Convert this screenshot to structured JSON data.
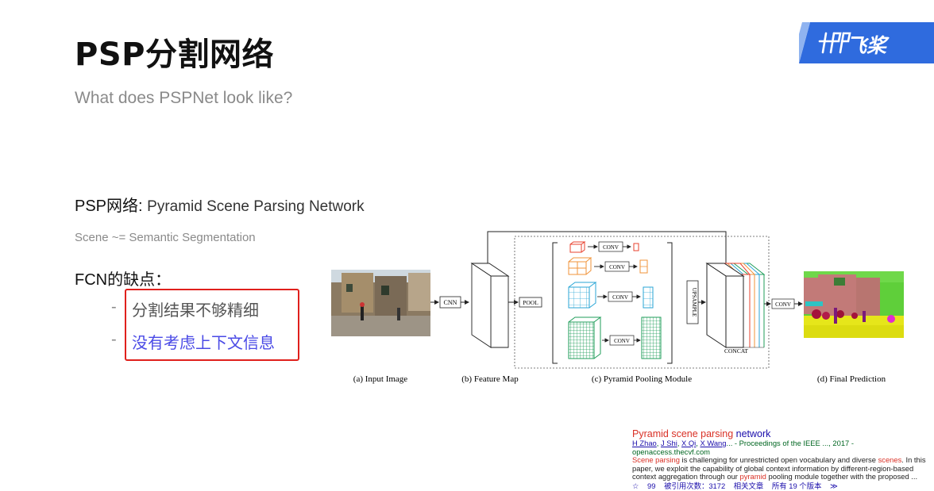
{
  "title": "PSP分割网络",
  "subtitle": "What does PSPNet look like?",
  "logo": {
    "text": "飞桨"
  },
  "psp": {
    "label": "PSP网络:",
    "full_name": "Pyramid Scene Parsing Network"
  },
  "scene_note": "Scene ~= Semantic Segmentation",
  "fcn": {
    "heading": "FCN的缺点：",
    "bullets": [
      {
        "dash": "-",
        "text": "分割结果不够精细"
      },
      {
        "dash": "-",
        "text": "没有考虑上下文信息"
      }
    ]
  },
  "diagram": {
    "blocks": {
      "cnn": "CNN",
      "pool": "POOL",
      "conv": "CONV",
      "upsample": "UPSAMPLE",
      "concat": "CONCAT"
    },
    "captions": {
      "a": "(a) Input Image",
      "b": "(b) Feature Map",
      "c": "(c) Pyramid Pooling Module",
      "d": "(d) Final Prediction"
    },
    "pyramid_colors": [
      "#e8402e",
      "#f0933a",
      "#2aa6d6",
      "#1f9e5a"
    ]
  },
  "citation": {
    "title_pre": "Pyramid scene parsing",
    "title_post": "network",
    "authors": [
      "H Zhao",
      "J Shi",
      "X Qi",
      "X Wang"
    ],
    "venue": "... - Proceedings of the IEEE ..., 2017 - openaccess.thecvf.com",
    "snippet_hl1": "Scene parsing",
    "snippet_1": "is challenging for unrestricted open vocabulary and diverse",
    "snippet_hl2": "scenes",
    "snippet_2": ". In this paper, we exploit the capability of global context information by different-region-based context aggregation through our",
    "snippet_hl3": "pyramid",
    "snippet_3": "pooling module together with the proposed ...",
    "actions": [
      "☆",
      "99",
      "被引用次数：3172",
      "相关文章",
      "所有 19 个版本",
      "≫"
    ]
  }
}
